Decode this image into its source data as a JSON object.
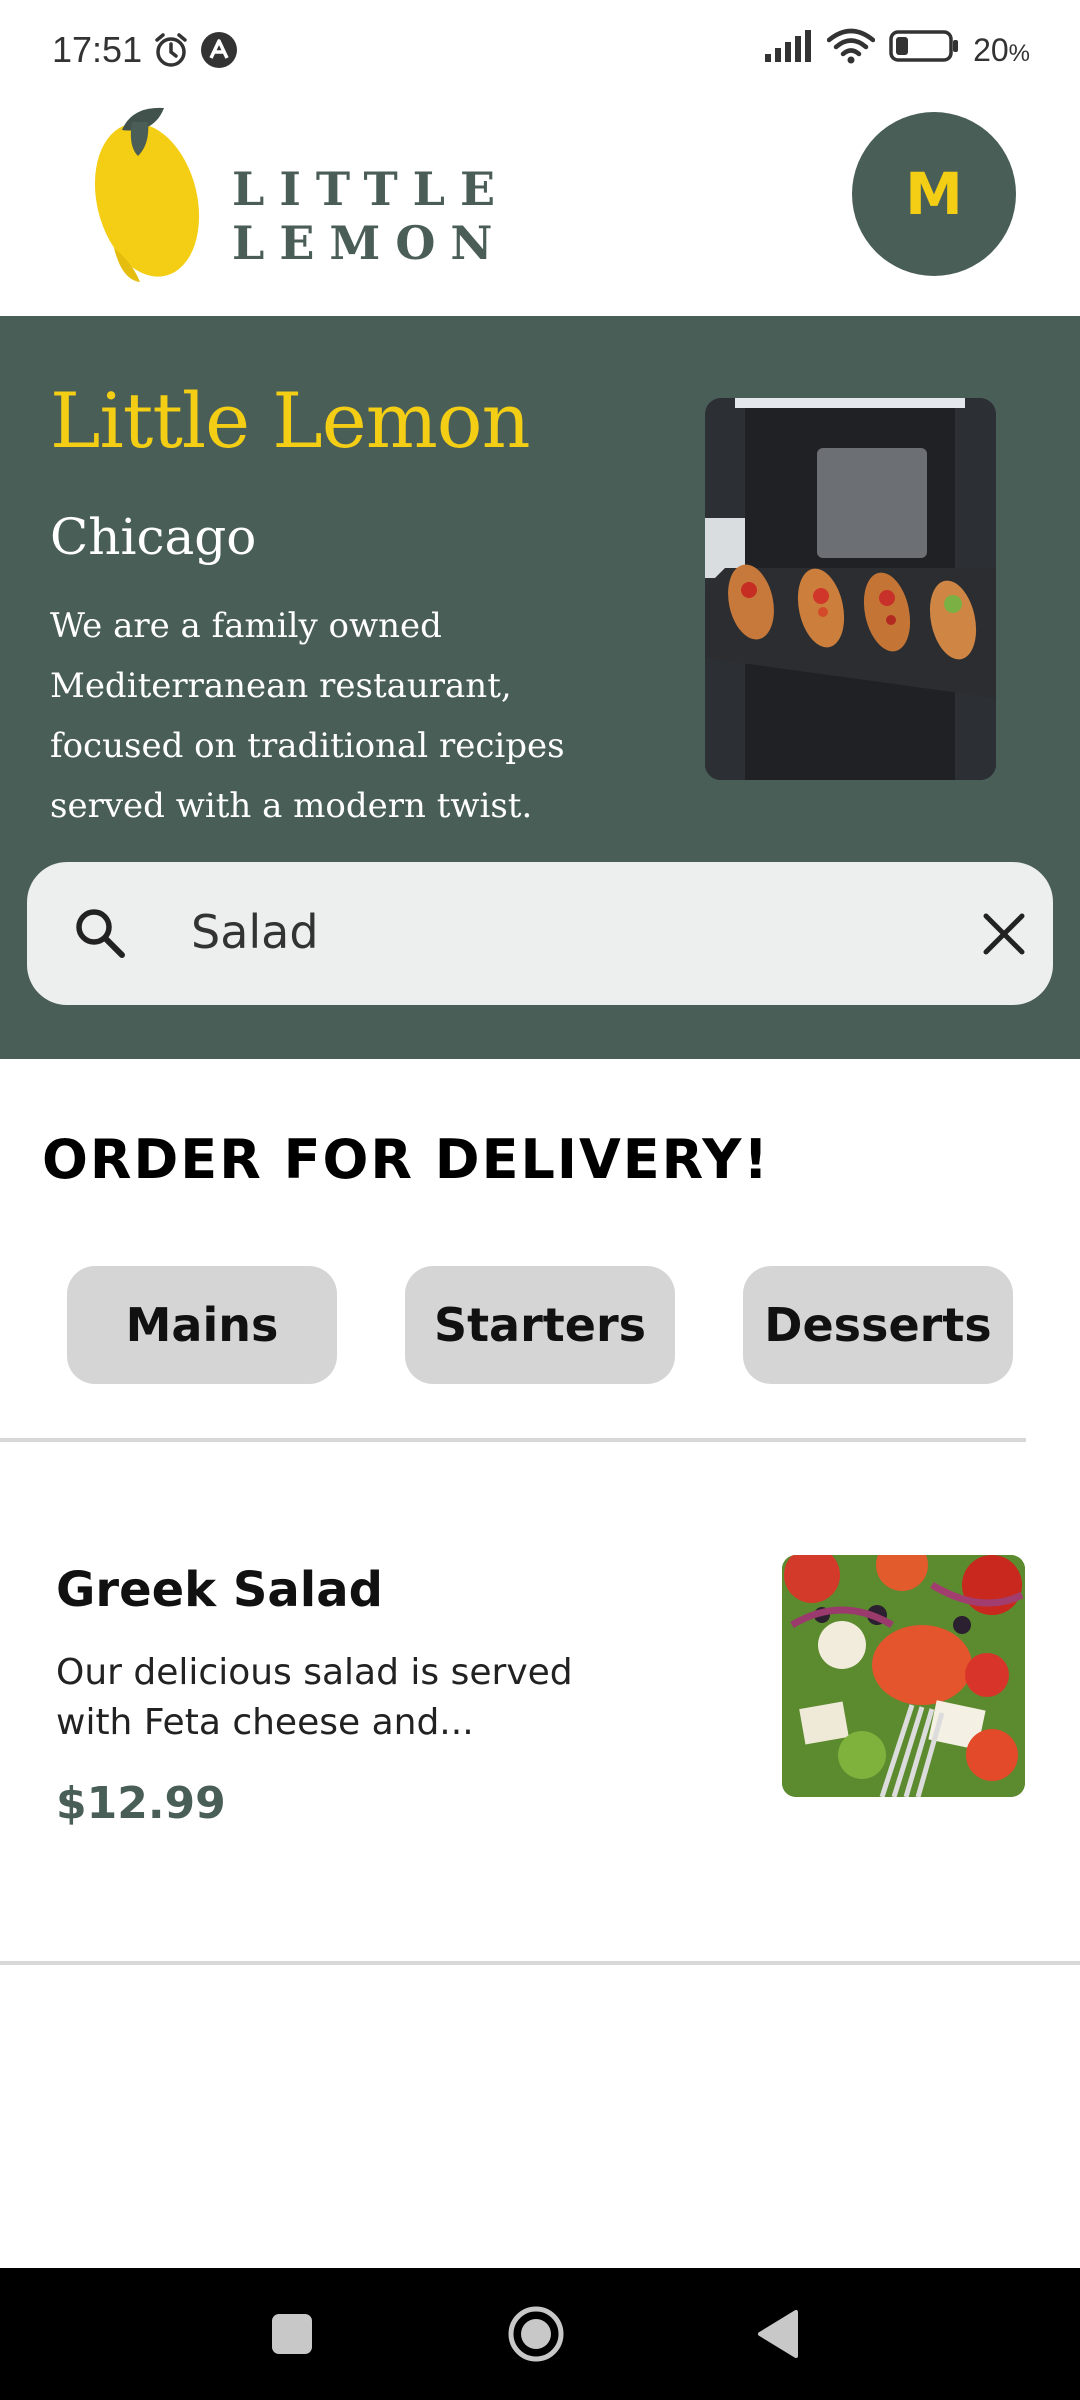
{
  "status_bar": {
    "time": "17:51",
    "battery": "20",
    "battery_unit": "%",
    "icons": [
      "alarm-icon",
      "app-notification-icon",
      "signal-icon",
      "wifi-icon",
      "battery-icon"
    ]
  },
  "header": {
    "logo_text": "LITTLE LEMON",
    "avatar_initial": "M"
  },
  "hero": {
    "title": "Little Lemon",
    "city": "Chicago",
    "description": "We are a family owned Mediterranean restaurant, focused on traditional recipes served with a modern twist."
  },
  "search": {
    "value": "Salad"
  },
  "order": {
    "title": "ORDER FOR DELIVERY!",
    "categories": [
      "Mains",
      "Starters",
      "Desserts"
    ]
  },
  "menu_items": [
    {
      "name": "Greek Salad",
      "description": "Our delicious salad is served with Feta cheese and...",
      "price": "$12.99"
    }
  ],
  "colors": {
    "primary_green": "#495e57",
    "primary_yellow": "#f4ce14",
    "search_bg": "#edefee",
    "category_bg": "#d5d5d5"
  }
}
